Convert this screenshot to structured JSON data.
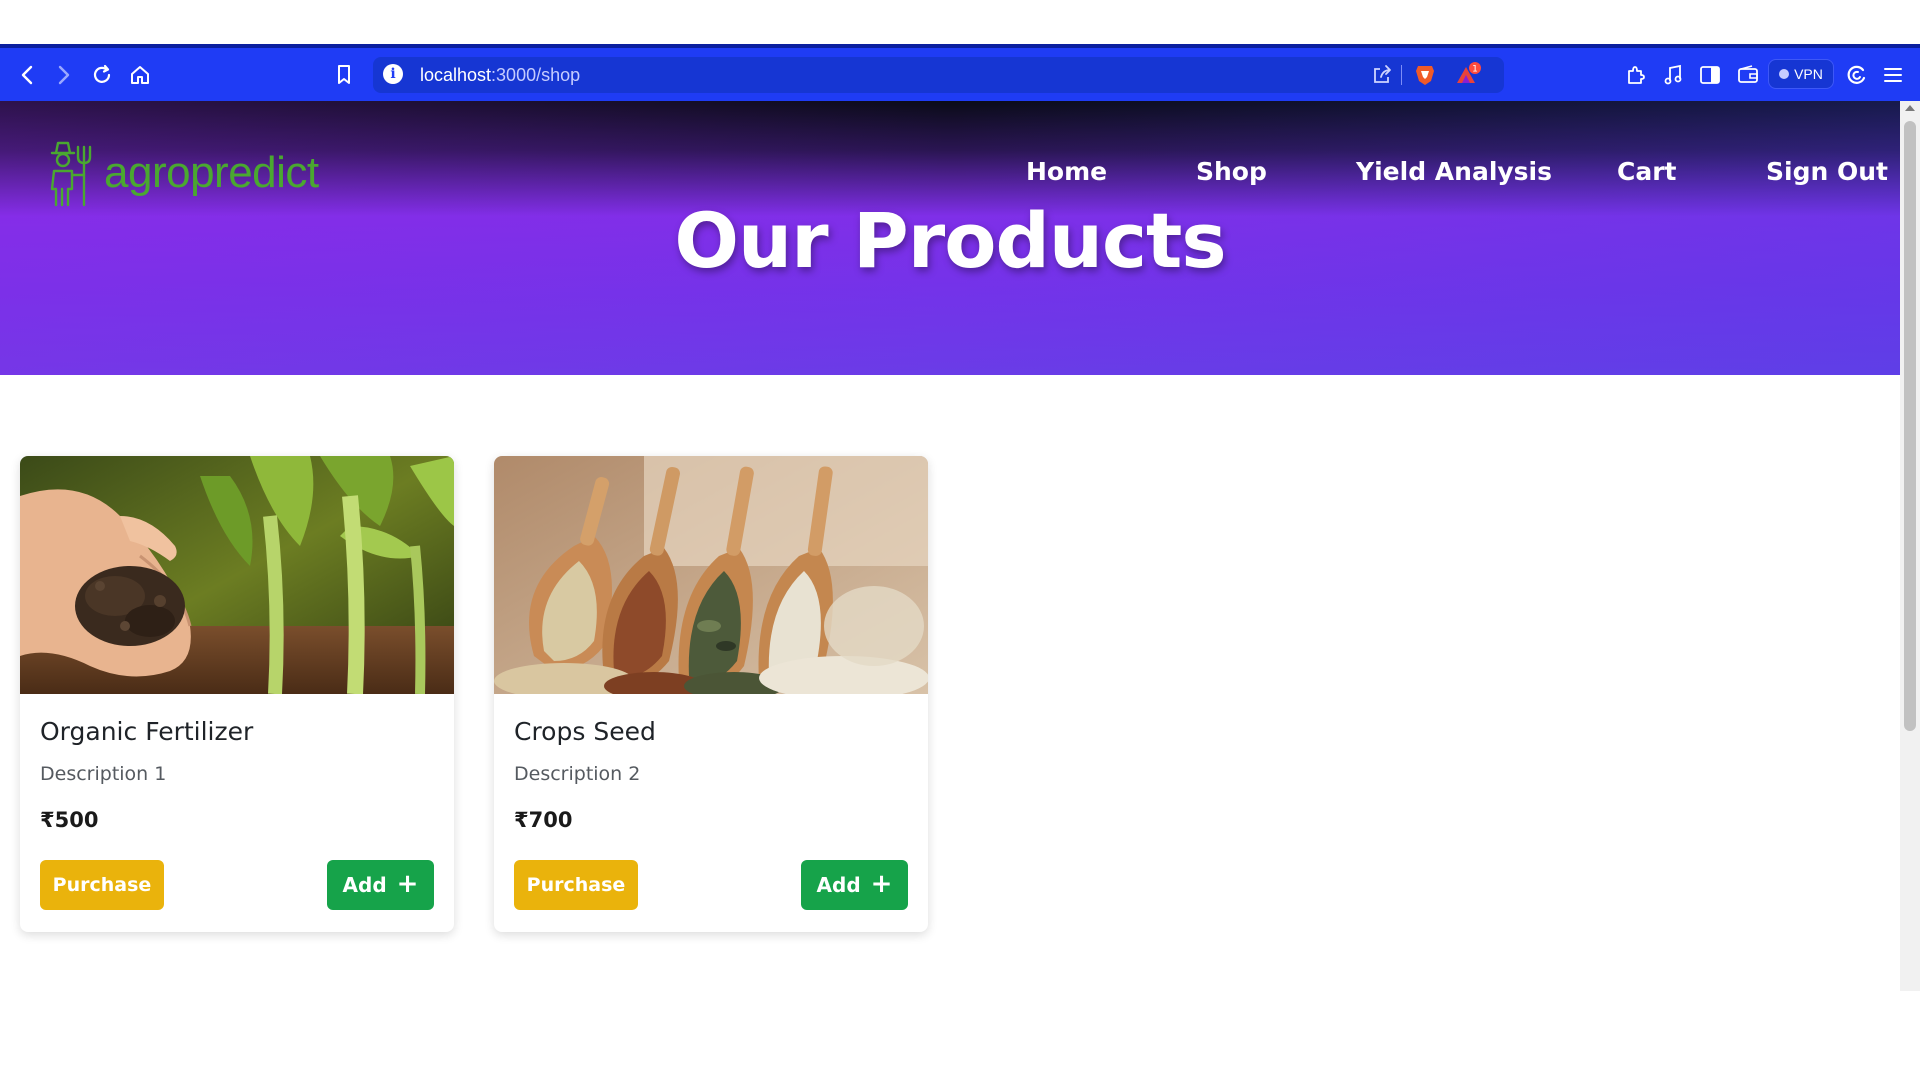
{
  "browser": {
    "url_host": "localhost",
    "url_port_path": ":3000/shop",
    "vpn_label": "VPN",
    "notification_count": "1"
  },
  "site": {
    "logo_text": "agropredict",
    "nav": [
      "Home",
      "Shop",
      "Yield Analysis",
      "Cart",
      "Sign Out"
    ],
    "hero_title": "Our Products"
  },
  "products": [
    {
      "title": "Organic Fertilizer",
      "description": "Description 1",
      "price": "₹500",
      "purchase_label": "Purchase",
      "add_label": "Add"
    },
    {
      "title": "Crops Seed",
      "description": "Description 2",
      "price": "₹700",
      "purchase_label": "Purchase",
      "add_label": "Add"
    }
  ],
  "colors": {
    "toolbar": "#1f3cf5",
    "logo_green": "#4aa830",
    "purchase_yellow": "#eab30c",
    "add_green": "#16a34a",
    "hero_purple": "#7f2fe8"
  }
}
